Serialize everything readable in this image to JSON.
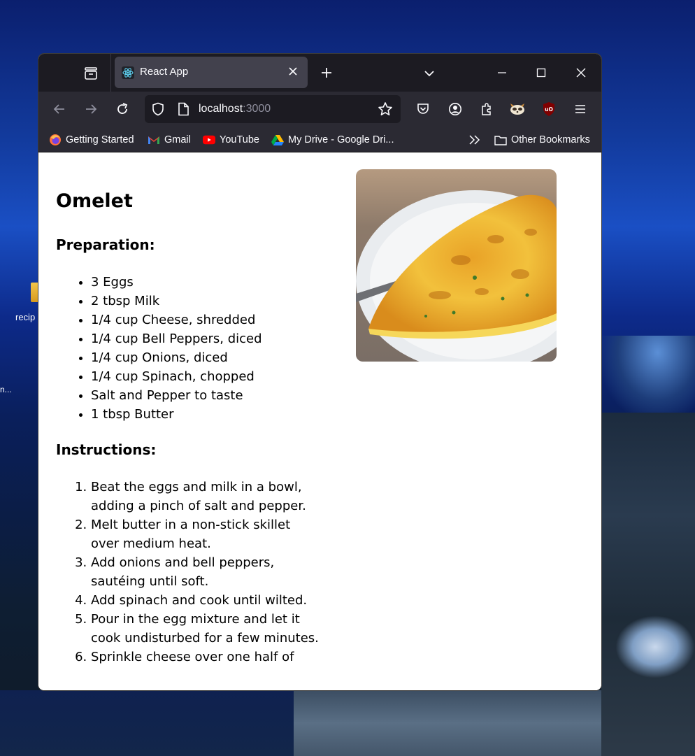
{
  "desktop": {
    "icon_label": "recip",
    "icon_label_2": "n..."
  },
  "browser": {
    "tab": {
      "title": "React App",
      "favicon": "react-icon"
    },
    "url": {
      "host": "localhost",
      "port": ":3000"
    },
    "bookmarks": [
      {
        "label": "Getting Started",
        "icon": "firefox-icon"
      },
      {
        "label": "Gmail",
        "icon": "gmail-icon"
      },
      {
        "label": "YouTube",
        "icon": "youtube-icon"
      },
      {
        "label": "My Drive - Google Dri...",
        "icon": "google-drive-icon"
      }
    ],
    "other_bookmarks": "Other Bookmarks"
  },
  "recipe": {
    "title": "Omelet",
    "preparation_heading": "Preparation:",
    "ingredients": [
      "3 Eggs",
      "2 tbsp Milk",
      "1/4 cup Cheese, shredded",
      "1/4 cup Bell Peppers, diced",
      "1/4 cup Onions, diced",
      "1/4 cup Spinach, chopped",
      "Salt and Pepper to taste",
      "1 tbsp Butter"
    ],
    "instructions_heading": "Instructions:",
    "instructions": [
      "Beat the eggs and milk in a bowl, adding a pinch of salt and pepper.",
      "Melt butter in a non-stick skillet over medium heat.",
      "Add onions and bell peppers, sautéing until soft.",
      "Add spinach and cook until wilted.",
      "Pour in the egg mixture and let it cook undisturbed for a few minutes.",
      "Sprinkle cheese over one half of"
    ]
  }
}
